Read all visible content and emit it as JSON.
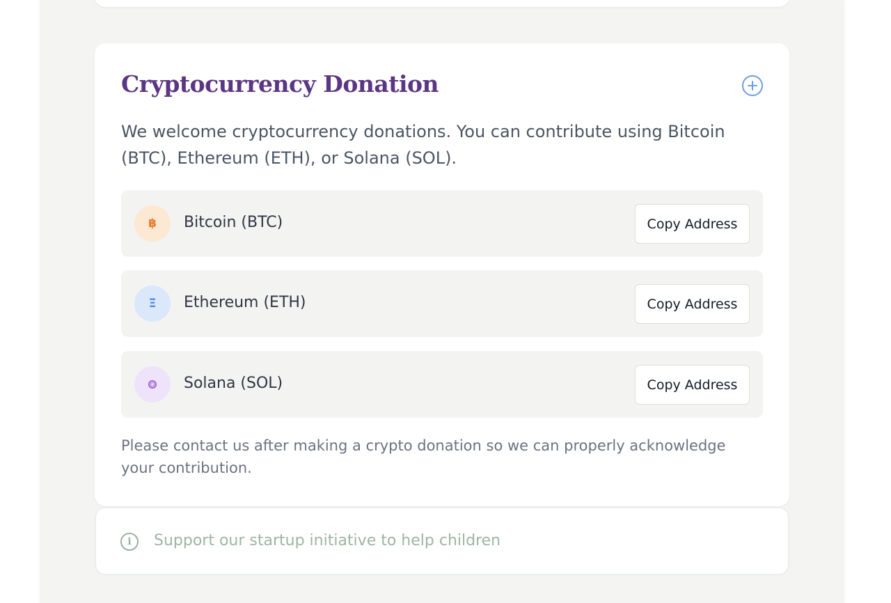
{
  "card": {
    "title": "Cryptocurrency Donation",
    "expand_icon": "plus-circle-icon",
    "intro": "We welcome cryptocurrency donations. You can contribute using Bitcoin (BTC), Ethereum (ETH), or Solana (SOL).",
    "currencies": [
      {
        "name": "Bitcoin (BTC)",
        "icon": "bitcoin-icon",
        "glyph": "฿",
        "button": "Copy Address",
        "color": "#ea7d2c"
      },
      {
        "name": "Ethereum (ETH)",
        "icon": "ethereum-icon",
        "glyph": "Ξ",
        "button": "Copy Address",
        "color": "#4e8ae8"
      },
      {
        "name": "Solana (SOL)",
        "icon": "solana-icon",
        "glyph": "",
        "button": "Copy Address",
        "color": "#a060d8"
      }
    ],
    "note": "Please contact us after making a crypto donation so we can properly acknowledge your contribution."
  },
  "banner": {
    "icon": "info-icon",
    "text": "Support our startup initiative to help children"
  },
  "colors": {
    "title": "#5b3682",
    "accent_blue": "#6b9de6",
    "banner_text": "#9fb5a3"
  }
}
